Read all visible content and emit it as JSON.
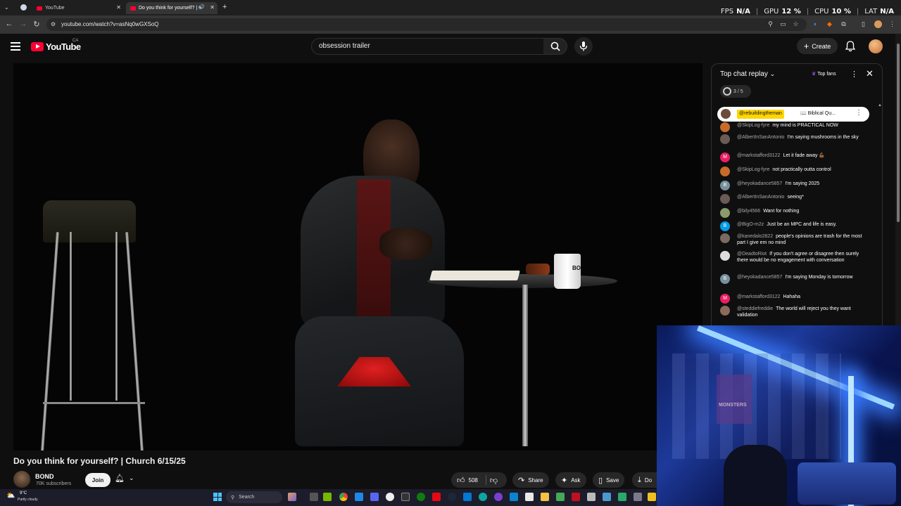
{
  "browser": {
    "tabs": [
      {
        "label": "YouTube"
      },
      {
        "label": "Do you think for yourself? | C"
      }
    ],
    "url": "youtube.com/watch?v=asNq0wGXSoQ",
    "stats": [
      {
        "label": "FPS",
        "value": "N/A"
      },
      {
        "label": "GPU",
        "value": "12 %"
      },
      {
        "label": "CPU",
        "value": "10 %"
      },
      {
        "label": "LAT",
        "value": "N/A"
      }
    ]
  },
  "masthead": {
    "logo": "YouTube",
    "country": "CA",
    "search_value": "obsession trailer",
    "create_label": "Create"
  },
  "video": {
    "title": "Do you think for yourself? | Church 6/15/25",
    "mug_text": "BO",
    "channel": {
      "name": "BOND",
      "subscribers": "70K subscribers",
      "join_label": "Join"
    },
    "actions": {
      "likes": "508",
      "share": "Share",
      "ask": "Ask",
      "save": "Save",
      "download": "Do"
    }
  },
  "chat": {
    "header": "Top chat replay",
    "top_fans": "Top fans",
    "reactions": "3 / 5",
    "pinned": {
      "author": "@rebuildingtheman",
      "text": "📖 Biblical Qu..."
    },
    "messages": [
      {
        "author": "@SkipLog-fyre",
        "text": "my mind is PRACTICAL NOW",
        "avatar": "",
        "avatar_color": "#c76b2b"
      },
      {
        "author": "@AlbertInSanAntonio",
        "text": "I'm saying mushrooms in the sky",
        "avatar": "",
        "avatar_color": "#6b5a55"
      },
      {
        "author": "@markstafford3122",
        "text": "Let it fade away 💪🏾",
        "avatar": "M",
        "avatar_color": "#e91e63"
      },
      {
        "author": "@SkipLog-fyre",
        "text": "not practically outta control",
        "avatar": "",
        "avatar_color": "#c76b2b"
      },
      {
        "author": "@heyokadance5857",
        "text": "I'm saying 2025",
        "avatar": "B",
        "avatar_color": "#78909c"
      },
      {
        "author": "@AlbertInSanAntonio",
        "text": "seeing*",
        "avatar": "",
        "avatar_color": "#6b5a55"
      },
      {
        "author": "@bily4566",
        "text": "Want for nothing",
        "avatar": "",
        "avatar_color": "#8a9a6a"
      },
      {
        "author": "@BigO-m2z",
        "text": "Just be an MPC and life is easy.",
        "avatar": "B",
        "avatar_color": "#039be5"
      },
      {
        "author": "@kanedalo2822",
        "text": "people's opinions are trash for the most part I give em no mind",
        "avatar": "",
        "avatar_color": "#7a6a60"
      },
      {
        "author": "@DeadtoRiot",
        "text": "If you don't agree or disagree then surely there would be no engagement with conversation",
        "avatar": "",
        "avatar_color": "#dddddd"
      },
      {
        "author": "@heyokadance5857",
        "text": "I'm saying Monday is tomorrow",
        "avatar": "B",
        "avatar_color": "#78909c"
      },
      {
        "author": "@markstafford3122",
        "text": "Hahaha",
        "avatar": "M",
        "avatar_color": "#e91e63"
      },
      {
        "author": "@steddiefreddie",
        "text": "The world will reject you they want validation",
        "avatar": "",
        "avatar_color": "#8a6a5a"
      }
    ]
  },
  "taskbar": {
    "weather_temp": "9°C",
    "weather_desc": "Partly cloudy",
    "search_label": "Search"
  },
  "webcam": {
    "poster_text": "MONSTERS"
  }
}
